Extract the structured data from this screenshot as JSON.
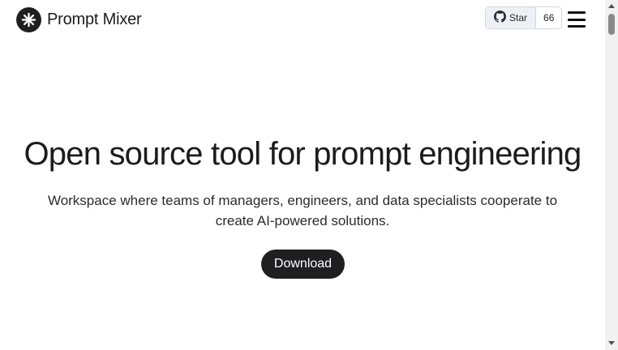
{
  "header": {
    "brand_name": "Prompt Mixer",
    "github": {
      "star_label": "Star",
      "star_count": "66"
    }
  },
  "hero": {
    "title": "Open source tool for prompt engineering",
    "subtitle": "Workspace where teams of managers, engineers, and data specialists cooperate to create AI-powered solutions.",
    "download_label": "Download"
  },
  "icons": {
    "logo": "asterisk-logo-icon",
    "github": "github-icon",
    "menu": "hamburger-menu-icon"
  },
  "colors": {
    "background": "#ffffff",
    "primary_button": "#1f1f22",
    "text": "#1c1c1e"
  }
}
